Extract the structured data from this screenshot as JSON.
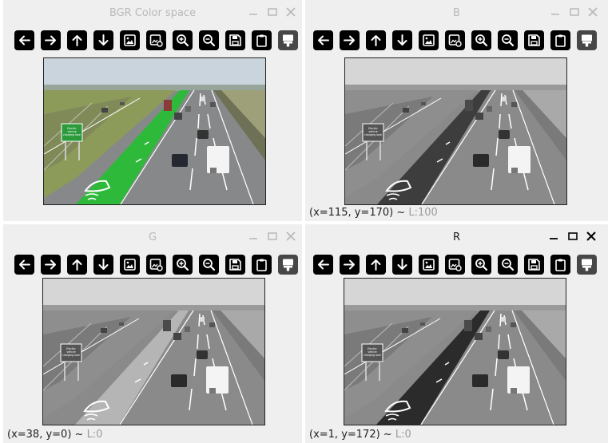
{
  "windows": [
    {
      "id": "bgr",
      "title": "BGR Color space",
      "status": {
        "coords": "",
        "value": ""
      },
      "active": false,
      "mode": "color"
    },
    {
      "id": "b",
      "title": "B",
      "status": {
        "coords": "(x=115, y=170) ~ ",
        "value": "L:100"
      },
      "active": false,
      "mode": "b"
    },
    {
      "id": "g",
      "title": "G",
      "status": {
        "coords": "(x=38, y=0) ~ ",
        "value": "L:0"
      },
      "active": false,
      "mode": "g"
    },
    {
      "id": "r",
      "title": "R",
      "status": {
        "coords": "(x=1, y=172) ~ ",
        "value": "L:0"
      },
      "active": true,
      "mode": "r"
    }
  ],
  "toolbar_icons": [
    "pan-left-icon",
    "pan-right-icon",
    "pan-up-icon",
    "pan-down-icon",
    "zoom-fit-icon",
    "zoom-original-icon",
    "zoom-in-icon",
    "zoom-out-icon",
    "save-icon",
    "copy-clipboard-icon",
    "properties-icon"
  ],
  "image_text": {
    "sign": "Electric vehicle charging lane"
  },
  "colors": {
    "lane_color": "#2fb93a",
    "lane_b": "#3d3d3d",
    "lane_g": "#b5b5b5",
    "lane_r": "#2b2b2b"
  }
}
